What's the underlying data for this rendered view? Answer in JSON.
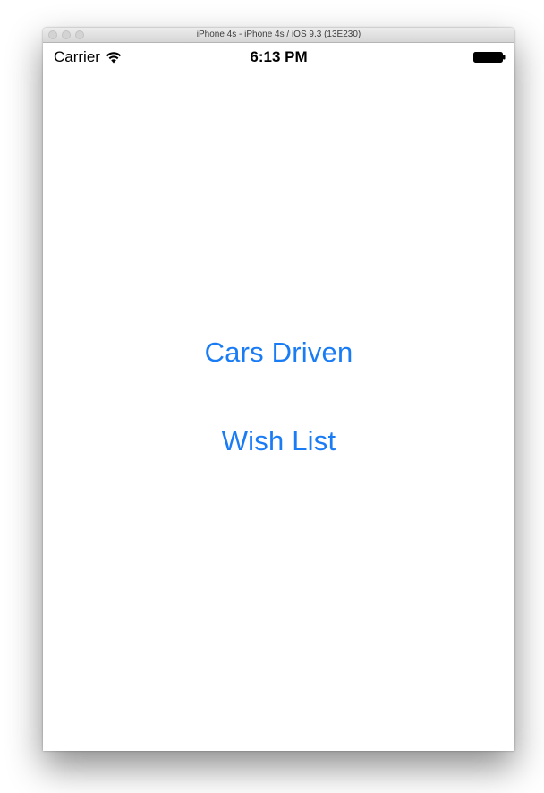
{
  "window": {
    "title": "iPhone 4s - iPhone 4s / iOS 9.3 (13E230)"
  },
  "status_bar": {
    "carrier": "Carrier",
    "time": "6:13 PM",
    "wifi_icon": "wifi-icon",
    "battery_icon": "battery-icon"
  },
  "main": {
    "buttons": [
      {
        "label": "Cars Driven"
      },
      {
        "label": "Wish List"
      }
    ]
  },
  "colors": {
    "accent": "#1a7cf5",
    "background": "#ffffff"
  }
}
